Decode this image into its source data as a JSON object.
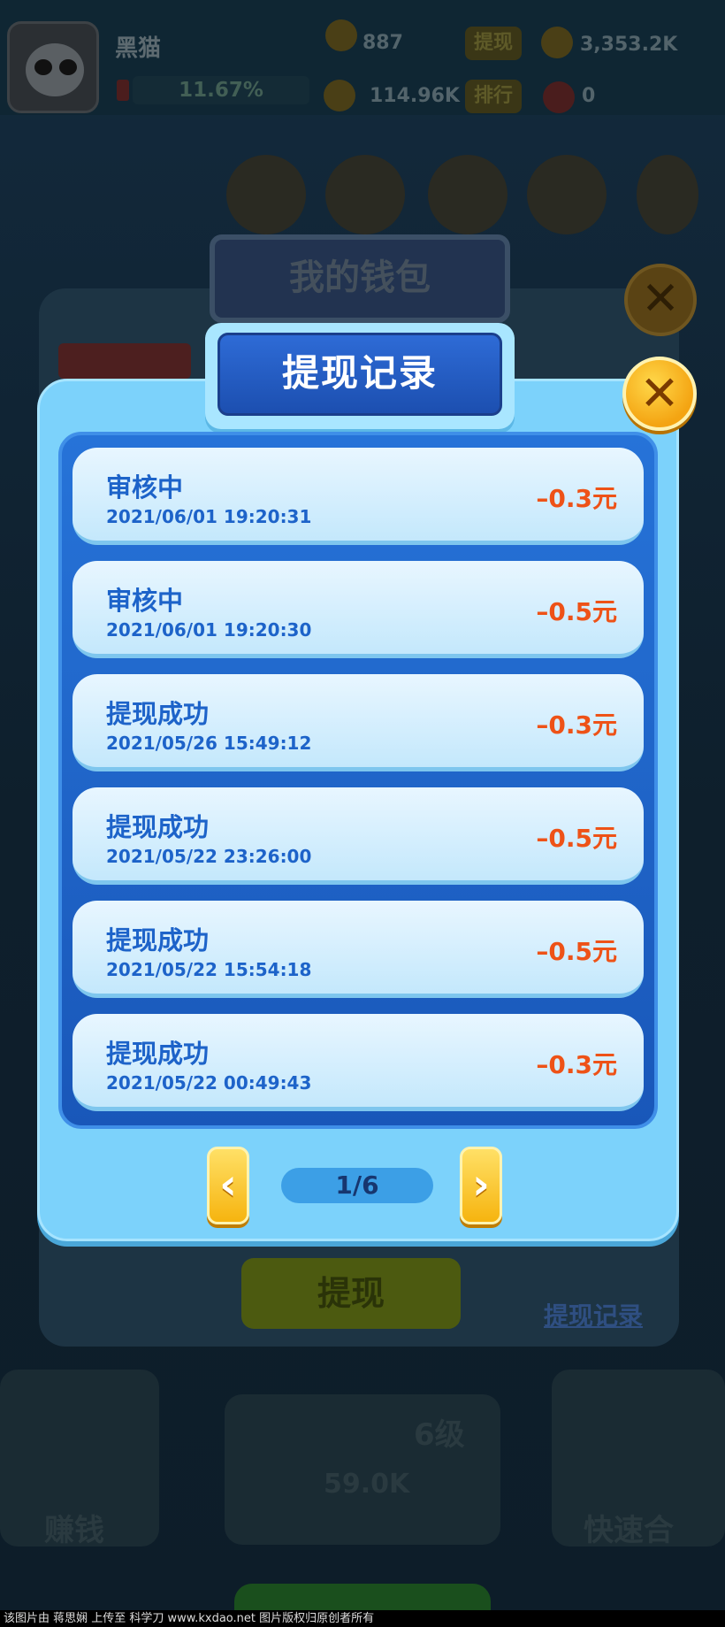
{
  "background": {
    "player_name": "黑猫",
    "percent": "11.67%",
    "stat_coins": "887",
    "stat_income": "114.96K",
    "stat_gold": "3,353.2K",
    "stat_hearts": "0",
    "btn_withdraw_top": "提现",
    "btn_rank_top": "排行",
    "wallet_title": "我的钱包",
    "close_glyph": "✕",
    "withdraw_button": "提现",
    "withdraw_record_link": "提现记录",
    "level_label": "6级",
    "level_value": "59.0K",
    "bottom_left": "赚钱",
    "bottom_right": "快速合"
  },
  "modal": {
    "title": "提现记录",
    "close_glyph": "✕",
    "records": [
      {
        "status": "审核中",
        "time": "2021/06/01 19:20:31",
        "amount": "–0.3元"
      },
      {
        "status": "审核中",
        "time": "2021/06/01 19:20:30",
        "amount": "–0.5元"
      },
      {
        "status": "提现成功",
        "time": "2021/05/26 15:49:12",
        "amount": "–0.3元"
      },
      {
        "status": "提现成功",
        "time": "2021/05/22 23:26:00",
        "amount": "–0.5元"
      },
      {
        "status": "提现成功",
        "time": "2021/05/22 15:54:18",
        "amount": "–0.5元"
      },
      {
        "status": "提现成功",
        "time": "2021/05/22 00:49:43",
        "amount": "–0.3元"
      }
    ],
    "pager": {
      "prev_glyph": "‹",
      "next_glyph": "›",
      "page": "1/6"
    }
  },
  "footer": {
    "watermark": "该图片由 蒋思娴 上传至 科学刀 www.kxdao.net 图片版权归原创者所有"
  },
  "colors": {
    "modal_bg": "#7cd2fb",
    "list_frame": "#2673d8",
    "title_bg": "#2e6bd6",
    "status_text": "#1d63c9",
    "amount_text": "#ee5217",
    "close_button": "#f4a412"
  }
}
